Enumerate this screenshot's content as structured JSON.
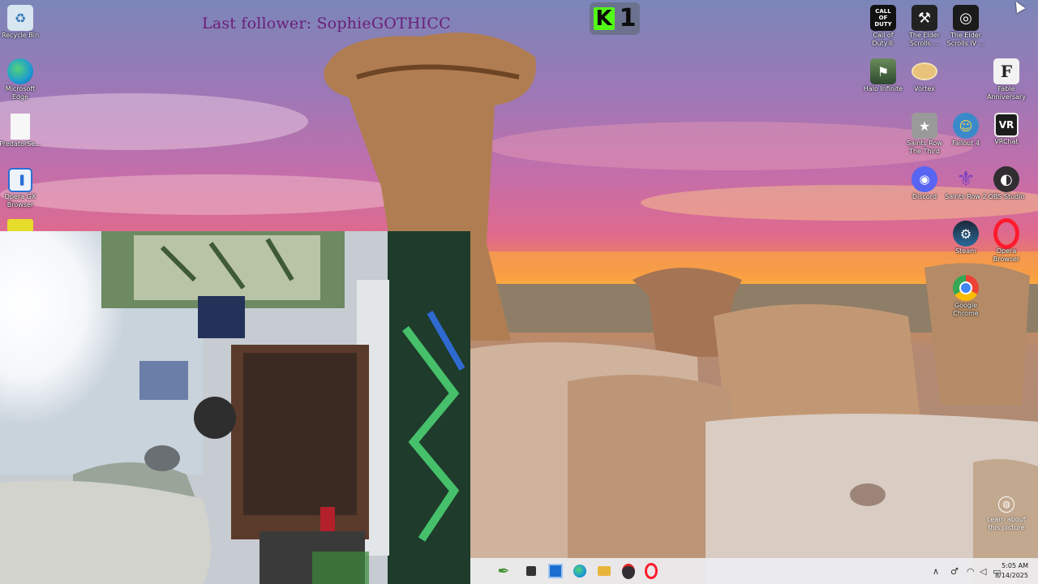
{
  "overlay": {
    "follower_text": "Last follower: SophieGOTHICC",
    "kick_logo": "K",
    "kick_count": "1"
  },
  "desktop_icons_left": [
    {
      "name": "recycle-bin-icon",
      "label": "Recycle Bin",
      "color": "#d8e6f0"
    },
    {
      "name": "edge-icon",
      "label": "Microsoft Edge",
      "color": "#1d9bd1"
    },
    {
      "name": "file-icon",
      "label": "PredatorSe...",
      "color": "#f2f2f2"
    },
    {
      "name": "opera-gx-icon",
      "label": "Opera GX Browser",
      "color": "#2a6fd6"
    }
  ],
  "desktop_icons_right": [
    {
      "name": "cod-icon",
      "label": "Call of Duty®",
      "color": "#111111",
      "glyph": "CALL OF DUTY"
    },
    {
      "name": "elder-scrolls-icon",
      "label": "The Elder Scrolls ...",
      "color": "#222222",
      "glyph": "⚒"
    },
    {
      "name": "elder-scrolls-iv-icon",
      "label": "The Elder Scrolls IV ...",
      "color": "#1b1b1b",
      "glyph": "◎"
    },
    {
      "name": "halo-icon",
      "label": "Halo Infinite",
      "color": "#3a5a3a",
      "glyph": "⚑"
    },
    {
      "name": "vortex-icon",
      "label": "Vortex",
      "color": "#e8c27a",
      "glyph": "○"
    },
    {
      "name": "fable-icon",
      "label": "Fable Anniversary",
      "color": "#f2f2f2",
      "glyph": "F"
    },
    {
      "name": "saints-row-3-icon",
      "label": "Saints Row The Third",
      "color": "#888888",
      "glyph": "★"
    },
    {
      "name": "fallout-4-icon",
      "label": "Fallout 4",
      "color": "#3a8acb",
      "glyph": "☺"
    },
    {
      "name": "vrchat-icon",
      "label": "VRChat",
      "color": "#1c1c1c",
      "glyph": "VR"
    },
    {
      "name": "discord-icon",
      "label": "Discord",
      "color": "#5865f2",
      "glyph": "◉"
    },
    {
      "name": "saints-row-2-icon",
      "label": "Saints Row 2",
      "color": "#6b2fa3",
      "glyph": "⚜"
    },
    {
      "name": "obs-icon",
      "label": "OBS Studio",
      "color": "#302e31",
      "glyph": "◐"
    },
    {
      "name": "steam-icon",
      "label": "Steam",
      "color": "#1b2838",
      "glyph": "⚙"
    },
    {
      "name": "opera-icon",
      "label": "Opera Browser",
      "color": "#ff1b2d",
      "glyph": "O"
    },
    {
      "name": "chrome-icon",
      "label": "Google Chrome",
      "color": "#4285f4",
      "glyph": "◉"
    }
  ],
  "learn_picture": {
    "label": "Learn about this picture"
  },
  "taskbar": {
    "icons": [
      {
        "name": "lizard-app-icon",
        "glyph": "✒",
        "color": "#3e8e2e"
      },
      {
        "name": "task-view-icon",
        "glyph": "■",
        "color": "#333"
      },
      {
        "name": "store-icon",
        "glyph": "▣",
        "color": "#1a6fd0"
      },
      {
        "name": "edge-taskbar-icon",
        "glyph": "◉",
        "color": "#1d9bd1"
      },
      {
        "name": "file-explorer-icon",
        "glyph": "▬",
        "color": "#e8b53a"
      },
      {
        "name": "obs-taskbar-icon",
        "glyph": "◐",
        "color": "#302e31"
      },
      {
        "name": "opera-taskbar-icon",
        "glyph": "O",
        "color": "#ff1b2d"
      }
    ],
    "tray": {
      "chevron": "∧",
      "mic": "♂",
      "wifi": "◠",
      "volume": "◁",
      "battery": "▭"
    },
    "time": "5:05 AM",
    "date": "8/14/2025"
  }
}
